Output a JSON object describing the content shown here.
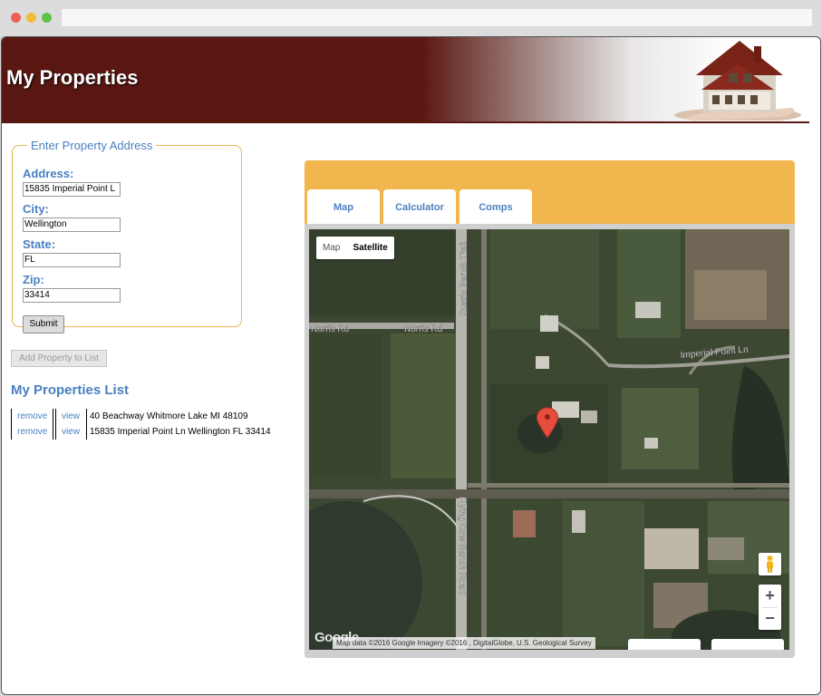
{
  "header": {
    "title": "My Properties"
  },
  "address_form": {
    "legend": "Enter Property Address",
    "address_label": "Address:",
    "address_value": "15835 Imperial Point L",
    "city_label": "City:",
    "city_value": "Wellington",
    "state_label": "State:",
    "state_value": "FL",
    "zip_label": "Zip:",
    "zip_value": "33414",
    "submit_label": "Submit"
  },
  "add_property_label": "Add Property to List",
  "properties_list": {
    "title": "My Properties List",
    "items": [
      {
        "remove": "remove",
        "view": "view",
        "address": "40 Beachway Whitmore Lake MI 48109"
      },
      {
        "remove": "remove",
        "view": "view",
        "address": "15835 Imperial Point Ln Wellington FL 33414"
      }
    ]
  },
  "tabs": [
    "Map",
    "Calculator",
    "Comps"
  ],
  "map": {
    "type_toggle": {
      "map": "Map",
      "satellite": "Satellite",
      "selected": "Satellite"
    },
    "road_labels": [
      "Norris Rd",
      "Norris Rd",
      "Rustic Ranch Trail",
      "Imperial Point Ln",
      "Flying Cow Ranch Road"
    ],
    "google_logo": "Google",
    "attribution": "Map data ©2016 Google Imagery ©2016 , DigitalGlobe, U.S. Geological Survey",
    "zoom_in": "+",
    "zoom_out": "−",
    "icons": {
      "marker": "map-marker-icon",
      "pegman": "pegman-icon"
    },
    "marker_color": "#e74c3c"
  },
  "colors": {
    "banner": "#5a1712",
    "accent": "#4a7fc1",
    "panel": "#f1b64e"
  }
}
